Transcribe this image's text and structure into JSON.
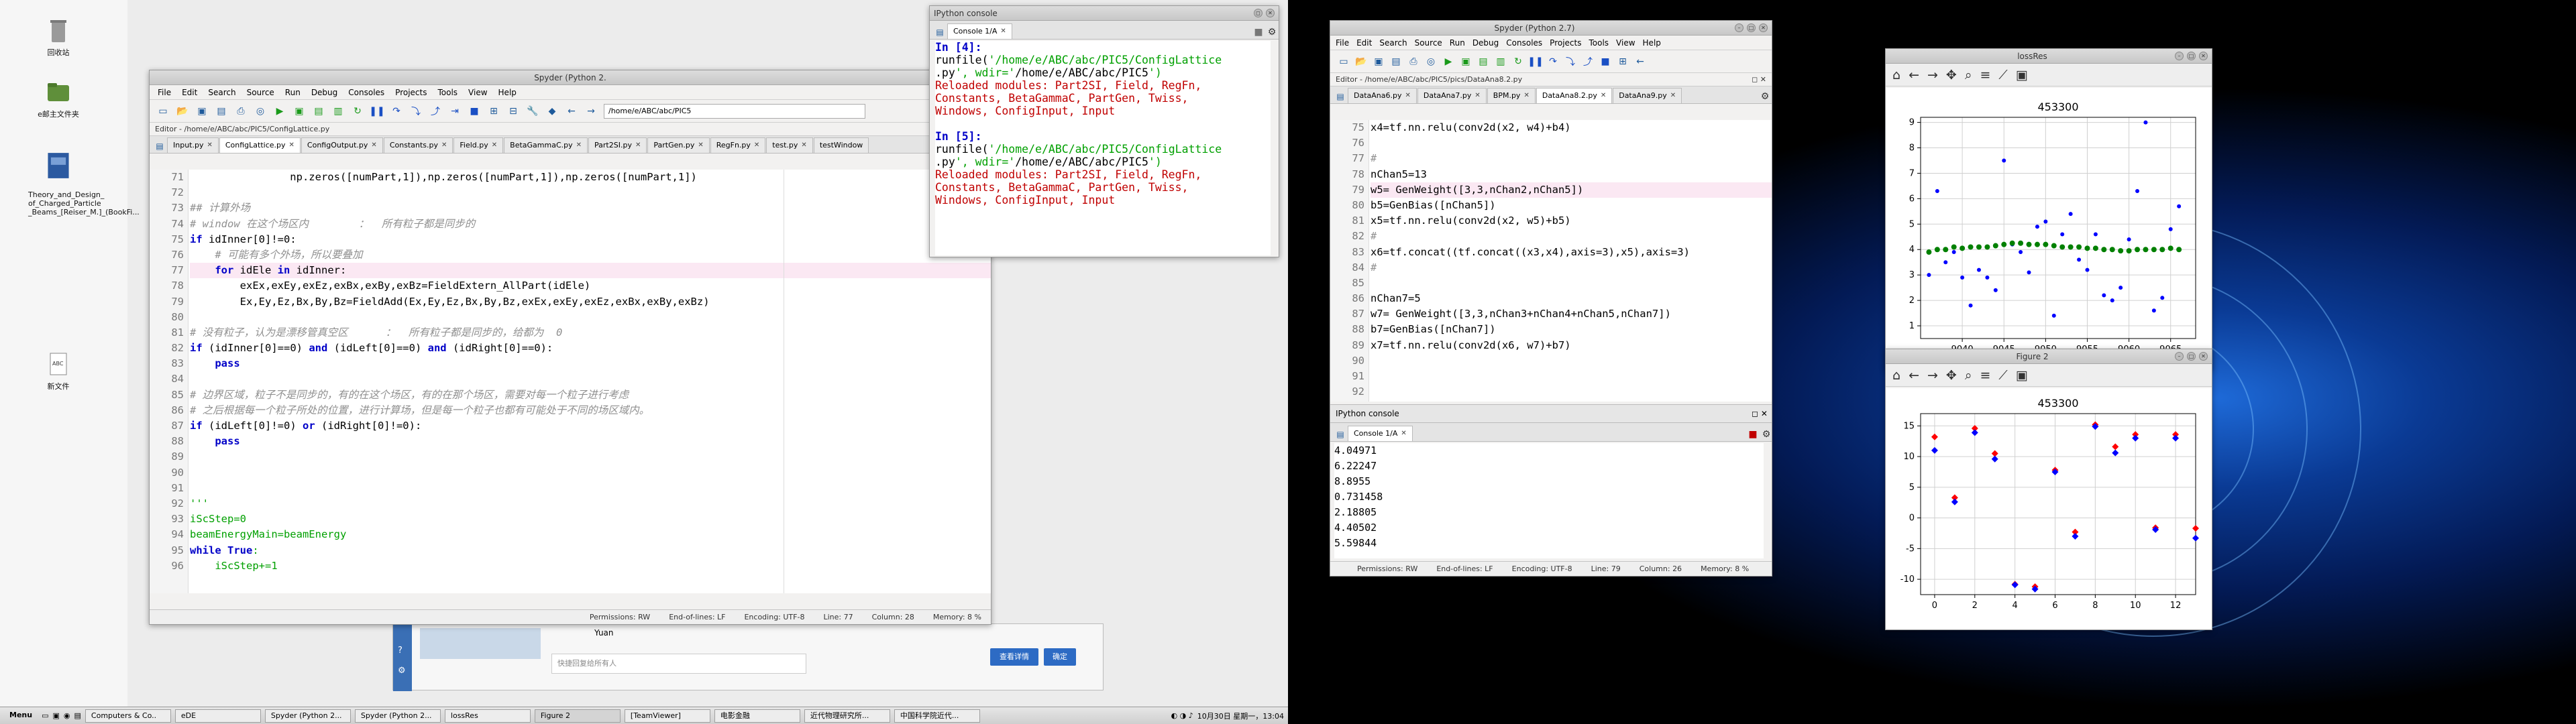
{
  "desktop": {
    "icons": [
      {
        "label": "回收站"
      },
      {
        "label": "e邮主文件夹"
      },
      {
        "label": "Theory_and_Design_\nof_Charged_Particle\n_Beams_[Reiser_M.]_(BookFi..."
      },
      {
        "label": "新文件"
      }
    ]
  },
  "spyder_left": {
    "title": "Spyder (Python 2.",
    "menus": [
      "File",
      "Edit",
      "Search",
      "Source",
      "Run",
      "Debug",
      "Consoles",
      "Projects",
      "Tools",
      "View",
      "Help"
    ],
    "path": "/home/e/ABC/abc/PIC5",
    "crumb": "Editor - /home/e/ABC/abc/PIC5/ConfigLattice.py",
    "tabs": [
      "Input.py",
      "ConfigLattice.py",
      "ConfigOutput.py",
      "Constants.py",
      "Field.py",
      "BetaGammaC.py",
      "Part2SI.py",
      "PartGen.py",
      "RegFn.py",
      "test.py",
      "testWindow"
    ],
    "lines": [
      {
        "n": "71",
        "t": "                np.zeros([numPart,1]),np.zeros([numPart,1]),np.zeros([numPart,1])"
      },
      {
        "n": "72",
        "t": ""
      },
      {
        "n": "73",
        "t": "## 计算外场"
      },
      {
        "n": "74",
        "t": "# window 在这个场区内        ：  所有粒子都是同步的"
      },
      {
        "n": "75",
        "t": "if idInner[0]!=0:"
      },
      {
        "n": "76",
        "t": "    # 可能有多个外场，所以要叠加"
      },
      {
        "n": "77",
        "t": "    for idEle in idInner:"
      },
      {
        "n": "78",
        "t": "        exEx,exEy,exEz,exBx,exBy,exBz=FieldExtern_AllPart(idEle)"
      },
      {
        "n": "79",
        "t": "        Ex,Ey,Ez,Bx,By,Bz=FieldAdd(Ex,Ey,Ez,Bx,By,Bz,exEx,exEy,exEz,exBx,exBy,exBz)"
      },
      {
        "n": "80",
        "t": ""
      },
      {
        "n": "81",
        "t": "# 没有粒子，认为是漂移管真空区      ：  所有粒子都是同步的，给都为  0"
      },
      {
        "n": "82",
        "t": "if (idInner[0]==0) and (idLeft[0]==0) and (idRight[0]==0):"
      },
      {
        "n": "83",
        "t": "    pass"
      },
      {
        "n": "84",
        "t": ""
      },
      {
        "n": "85",
        "t": "# 边界区域，粒子不是同步的，有的在这个场区，有的在那个场区，需要对每一个粒子进行考虑"
      },
      {
        "n": "86",
        "t": "# 之后根据每一个粒子所处的位置，进行计算场，但是每一个粒子也都有可能处于不同的场区域内。"
      },
      {
        "n": "87",
        "t": "if (idLeft[0]!=0) or (idRight[0]!=0):"
      },
      {
        "n": "88",
        "t": "    pass"
      },
      {
        "n": "89",
        "t": ""
      },
      {
        "n": "90",
        "t": ""
      },
      {
        "n": "91",
        "t": ""
      },
      {
        "n": "92",
        "t": "'''"
      },
      {
        "n": "93",
        "t": "iScStep=0"
      },
      {
        "n": "94",
        "t": "beamEnergyMain=beamEnergy"
      },
      {
        "n": "95",
        "t": "while True:"
      },
      {
        "n": "96",
        "t": "    iScStep+=1"
      }
    ],
    "status": [
      "Permissions: RW",
      "End-of-lines: LF",
      "Encoding: UTF-8",
      "Line: 77",
      "Column: 28",
      "Memory: 8 %"
    ]
  },
  "ipython_small": {
    "title": "IPython console",
    "tab": "Console 1/A",
    "lines": [
      "In [4]:",
      "runfile('/home/e/ABC/abc/PIC5/ConfigLattice",
      ".py', wdir='/home/e/ABC/abc/PIC5')",
      "Reloaded modules: Part2SI, Field, RegFn,",
      "Constants, BetaGammaC, PartGen, Twiss,",
      "Windows, ConfigInput, Input",
      "",
      "In [5]:",
      "runfile('/home/e/ABC/abc/PIC5/ConfigLattice",
      ".py', wdir='/home/e/ABC/abc/PIC5')",
      "Reloaded modules: Part2SI, Field, RegFn,",
      "Constants, BetaGammaC, PartGen, Twiss,",
      "Windows, ConfigInput, Input"
    ]
  },
  "dialog": {
    "user": "Yuan",
    "placeholder": "快捷回复给所有人",
    "btn_detail": "查看详情",
    "btn_ok": "确定"
  },
  "spyder_right": {
    "title": "Spyder (Python 2.7)",
    "menus": [
      "File",
      "Edit",
      "Search",
      "Source",
      "Run",
      "Debug",
      "Consoles",
      "Projects",
      "Tools",
      "View",
      "Help"
    ],
    "crumb": "Editor - /home/e/ABC/abc/PIC5/pics/DataAna8.2.py",
    "tabs": [
      "DataAna6.py",
      "DataAna7.py",
      "BPM.py",
      "DataAna8.2.py",
      "DataAna9.py"
    ],
    "lines": [
      {
        "n": "75",
        "t": "x4=tf.nn.relu(conv2d(x2, w4)+b4)"
      },
      {
        "n": "76",
        "t": ""
      },
      {
        "n": "77",
        "t": "#"
      },
      {
        "n": "78",
        "t": "nChan5=13"
      },
      {
        "n": "79",
        "t": "w5= GenWeight([3,3,nChan2,nChan5])"
      },
      {
        "n": "80",
        "t": "b5=GenBias([nChan5])"
      },
      {
        "n": "81",
        "t": "x5=tf.nn.relu(conv2d(x2, w5)+b5)"
      },
      {
        "n": "82",
        "t": "#"
      },
      {
        "n": "83",
        "t": "x6=tf.concat((tf.concat((x3,x4),axis=3),x5),axis=3)"
      },
      {
        "n": "84",
        "t": "#"
      },
      {
        "n": "85",
        "t": ""
      },
      {
        "n": "86",
        "t": "nChan7=5"
      },
      {
        "n": "87",
        "t": "w7= GenWeight([3,3,nChan3+nChan4+nChan5,nChan7])"
      },
      {
        "n": "88",
        "t": "b7=GenBias([nChan7])"
      },
      {
        "n": "89",
        "t": "x7=tf.nn.relu(conv2d(x6, w7)+b7)"
      },
      {
        "n": "90",
        "t": ""
      },
      {
        "n": "91",
        "t": ""
      },
      {
        "n": "92",
        "t": ""
      }
    ],
    "console_title": "IPython console",
    "console_tab": "Console 1/A",
    "console_lines": [
      "4.04971",
      "6.22247",
      "8.8955",
      "0.731458",
      "2.18805",
      "4.40502",
      "5.59844"
    ],
    "status": [
      "Permissions: RW",
      "End-of-lines: LF",
      "Encoding: UTF-8",
      "Line: 79",
      "Column: 26",
      "Memory: 8 %"
    ]
  },
  "fig_loss": {
    "title": "lossRes",
    "plot_title": "453300"
  },
  "fig2": {
    "title": "Figure 2",
    "plot_title": "453300"
  },
  "taskbar": {
    "menu": "Menu",
    "items": [
      "Computers & Co..",
      "eDE",
      "Spyder (Python 2...",
      "Spyder (Python 2...",
      "lossRes",
      "Figure 2",
      "[TeamViewer]",
      "电影金融",
      "近代物理研究所...",
      "中国科学院近代...",
      "",
      ""
    ],
    "clock": "10月30日 星期一，13:04"
  },
  "chart_data": [
    {
      "type": "scatter",
      "title": "453300",
      "xlim": [
        9035,
        9068
      ],
      "ylim": [
        0.5,
        9.2
      ],
      "xticks": [
        9040,
        9045,
        9050,
        9055,
        9060,
        9065
      ],
      "yticks": [
        1,
        2,
        3,
        4,
        5,
        6,
        7,
        8,
        9
      ],
      "series": [
        {
          "color": "#0000ff",
          "x": [
            9036,
            9037,
            9038,
            9039,
            9040,
            9041,
            9042,
            9043,
            9044,
            9045,
            9046,
            9047,
            9048,
            9049,
            9050,
            9051,
            9052,
            9053,
            9054,
            9055,
            9056,
            9057,
            9058,
            9059,
            9060,
            9061,
            9062,
            9063,
            9064,
            9065,
            9066
          ],
          "y": [
            3.0,
            6.3,
            3.5,
            3.9,
            2.9,
            1.8,
            3.2,
            2.9,
            2.4,
            7.5,
            4.2,
            3.9,
            3.1,
            4.9,
            5.1,
            1.4,
            4.6,
            5.4,
            3.6,
            3.2,
            4.6,
            2.2,
            2.0,
            2.5,
            4.4,
            6.3,
            9.0,
            1.6,
            2.1,
            4.8,
            5.7
          ]
        },
        {
          "color": "#008000",
          "x": [
            9036,
            9037,
            9038,
            9039,
            9040,
            9041,
            9042,
            9043,
            9044,
            9045,
            9046,
            9047,
            9048,
            9049,
            9050,
            9051,
            9052,
            9053,
            9054,
            9055,
            9056,
            9057,
            9058,
            9059,
            9060,
            9061,
            9062,
            9063,
            9064,
            9065,
            9066
          ],
          "y": [
            3.9,
            4.0,
            4.0,
            4.1,
            4.05,
            4.1,
            4.1,
            4.1,
            4.15,
            4.2,
            4.25,
            4.25,
            4.2,
            4.2,
            4.2,
            4.15,
            4.1,
            4.1,
            4.1,
            4.05,
            4.05,
            4.0,
            4.0,
            3.95,
            3.95,
            4.0,
            4.0,
            4.0,
            4.0,
            4.05,
            4.0
          ]
        }
      ]
    },
    {
      "type": "scatter",
      "title": "453300",
      "xlim": [
        -0.7,
        13
      ],
      "ylim": [
        -12.5,
        17
      ],
      "xticks": [
        0,
        2,
        4,
        6,
        8,
        10,
        12
      ],
      "yticks": [
        -10,
        -5,
        0,
        5,
        10,
        15
      ],
      "series": [
        {
          "color": "#ff0000",
          "x": [
            0,
            1,
            2,
            3,
            4,
            5,
            6,
            7,
            8,
            9,
            10,
            11,
            12,
            13
          ],
          "y": [
            13.2,
            3.3,
            14.6,
            10.5,
            -10.8,
            -11.2,
            7.8,
            -2.3,
            15.2,
            11.6,
            13.6,
            -1.6,
            13.6,
            -1.7
          ]
        },
        {
          "color": "#0000ff",
          "x": [
            0,
            1,
            2,
            3,
            4,
            5,
            6,
            7,
            8,
            9,
            10,
            11,
            12,
            13
          ],
          "y": [
            11.0,
            2.6,
            13.9,
            9.6,
            -10.9,
            -11.6,
            7.5,
            -3.0,
            14.9,
            10.6,
            13.0,
            -1.9,
            13.0,
            -3.3
          ]
        }
      ]
    }
  ]
}
